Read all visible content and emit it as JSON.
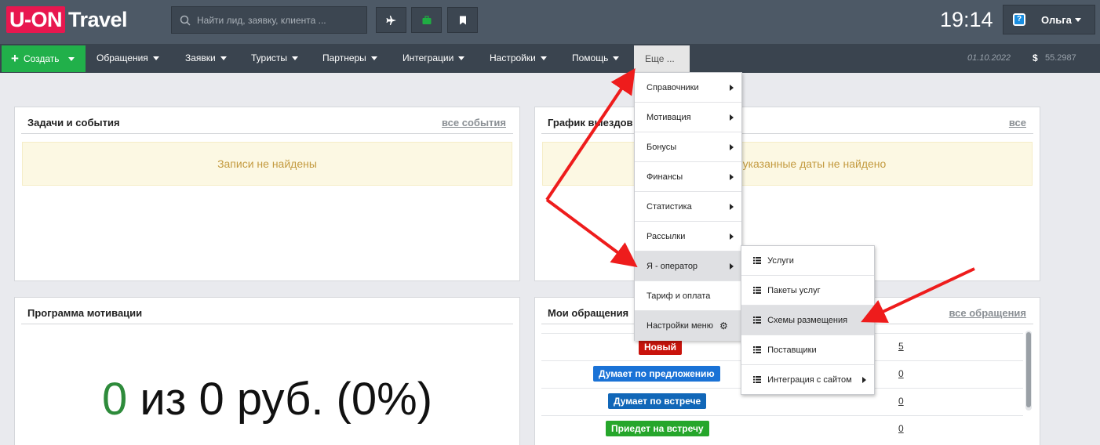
{
  "header": {
    "logo_box": "U-ON",
    "logo_text": "Travel",
    "search_placeholder": "Найти лид, заявку, клиента ...",
    "tool_icons": [
      "plane-icon",
      "briefcase-icon",
      "bookmark-icon"
    ],
    "clock": "19:14",
    "help_label": "?",
    "user_name": "Ольга"
  },
  "nav": {
    "create_label": "Создать",
    "items": [
      "Обращения",
      "Заявки",
      "Туристы",
      "Партнеры",
      "Интеграции",
      "Настройки",
      "Помощь"
    ],
    "more_label": "Еще ...",
    "date": "01.10.2022",
    "currency_symbol": "$",
    "rate": "55.2987"
  },
  "panels": {
    "tasks": {
      "title": "Задачи и события",
      "link": "все события",
      "empty_text": "Записи не найдены"
    },
    "schedule": {
      "title": "График выездов",
      "link": "все",
      "empty_text": "Ничего на указанные даты не найдено"
    },
    "motivation": {
      "title": "Программа мотивации",
      "value_green": "0",
      "value_text": "из 0 руб. (0%)"
    },
    "requests": {
      "title": "Мои обращения",
      "link": "все обращения",
      "rows": [
        {
          "status": "Новый",
          "count": "5"
        },
        {
          "status": "Думает по предложению",
          "count": "0"
        },
        {
          "status": "Думает по встрече",
          "count": "0"
        },
        {
          "status": "Приедет на встречу",
          "count": "0"
        }
      ]
    }
  },
  "more_menu": {
    "items": [
      "Справочники",
      "Мотивация",
      "Бонусы",
      "Финансы",
      "Статистика",
      "Рассылки",
      "Я - оператор",
      "Тариф и оплата",
      "Настройки меню"
    ]
  },
  "operator_submenu": {
    "items": [
      "Услуги",
      "Пакеты услуг",
      "Схемы размещения",
      "Поставщики",
      "Интеграция с сайтом"
    ]
  },
  "colors": {
    "header_bg": "#4d5966",
    "nav_bg": "#3a444f",
    "logo_red": "#e8174f",
    "create_green": "#21b04a",
    "status_new": "#c9130c",
    "status_blue": "#1a72d6",
    "status_green": "#26a62b",
    "arrow_red": "#ee1c1c"
  }
}
